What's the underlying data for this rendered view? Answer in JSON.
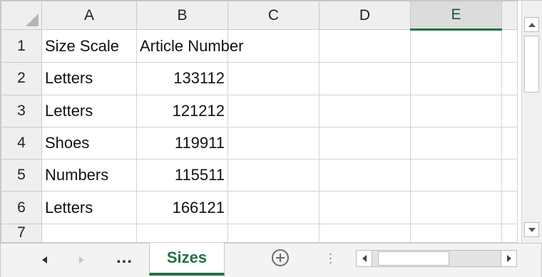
{
  "spreadsheet": {
    "columns": [
      "A",
      "B",
      "C",
      "D",
      "E"
    ],
    "selected_column": "E",
    "rows": [
      {
        "num": "1",
        "a": "Size Scale",
        "b": "Article Number"
      },
      {
        "num": "2",
        "a": "Letters",
        "b": "133112"
      },
      {
        "num": "3",
        "a": "Letters",
        "b": "121212"
      },
      {
        "num": "4",
        "a": "Shoes",
        "b": "119911"
      },
      {
        "num": "5",
        "a": "Numbers",
        "b": "115511"
      },
      {
        "num": "6",
        "a": "Letters",
        "b": "166121"
      },
      {
        "num": "7",
        "a": "",
        "b": ""
      }
    ]
  },
  "sheet_tabs": {
    "more_label": "...",
    "active_tab": "Sizes"
  },
  "icons": {
    "select_all": "select-all-triangle",
    "scroll_up": "triangle-up",
    "scroll_down": "triangle-down",
    "tab_prev": "triangle-left",
    "tab_next": "triangle-right",
    "new_sheet": "plus-circle"
  },
  "colors": {
    "accent": "#217346",
    "header_bg": "#efefef",
    "gridline": "#d4d4d4"
  }
}
